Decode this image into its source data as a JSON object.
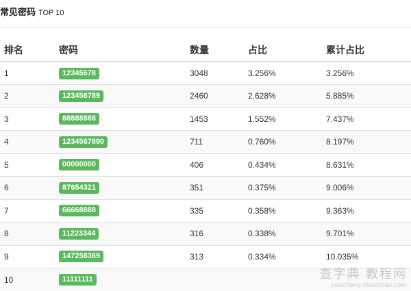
{
  "header": {
    "title": "常见密码",
    "subtitle": "TOP 10"
  },
  "table": {
    "columns": [
      "排名",
      "密码",
      "数量",
      "占比",
      "累计占比"
    ],
    "rows": [
      {
        "rank": "1",
        "password": "12345678",
        "count": "3048",
        "pct": "3.256%",
        "cum": "3.256%"
      },
      {
        "rank": "2",
        "password": "123456789",
        "count": "2460",
        "pct": "2.628%",
        "cum": "5.885%"
      },
      {
        "rank": "3",
        "password": "88888888",
        "count": "1453",
        "pct": "1.552%",
        "cum": "7.437%"
      },
      {
        "rank": "4",
        "password": "1234567890",
        "count": "711",
        "pct": "0.760%",
        "cum": "8.197%"
      },
      {
        "rank": "5",
        "password": "00000000",
        "count": "406",
        "pct": "0.434%",
        "cum": "8.631%"
      },
      {
        "rank": "6",
        "password": "87654321",
        "count": "351",
        "pct": "0.375%",
        "cum": "9.006%"
      },
      {
        "rank": "7",
        "password": "66668888",
        "count": "335",
        "pct": "0.358%",
        "cum": "9.363%"
      },
      {
        "rank": "8",
        "password": "11223344",
        "count": "316",
        "pct": "0.338%",
        "cum": "9.701%"
      },
      {
        "rank": "9",
        "password": "147258369",
        "count": "313",
        "pct": "0.334%",
        "cum": "10.035%"
      },
      {
        "rank": "10",
        "password": "11111111",
        "count": "",
        "pct": "",
        "cum": ""
      }
    ]
  },
  "watermark": {
    "main": "查字典 教程网",
    "url": "jiaocheng.chazidian.com"
  },
  "colors": {
    "label_bg": "#5cb85c",
    "stripe": "#f9f9f9",
    "border": "#dddddd"
  }
}
